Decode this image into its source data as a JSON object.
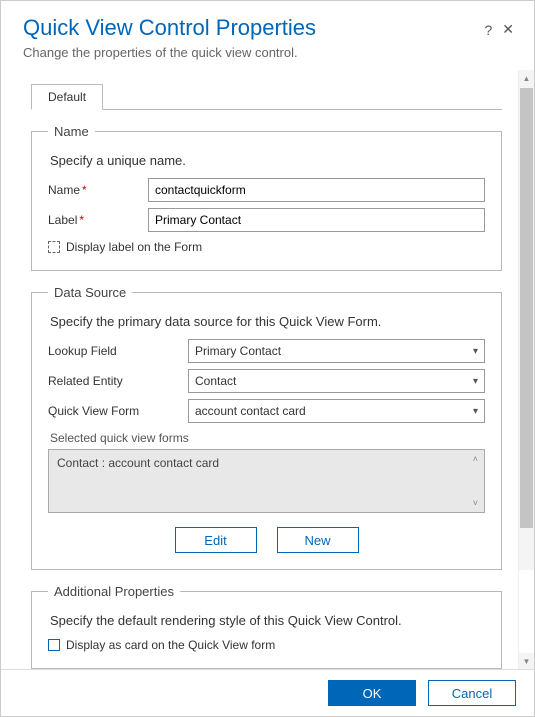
{
  "header": {
    "title": "Quick View Control Properties",
    "subtitle": "Change the properties of the quick view control."
  },
  "tabs": {
    "default": "Default"
  },
  "name_section": {
    "legend": "Name",
    "desc": "Specify a unique name.",
    "name_label": "Name",
    "name_value": "contactquickform",
    "label_label": "Label",
    "label_value": "Primary Contact",
    "display_label": "Display label on the Form"
  },
  "data_section": {
    "legend": "Data Source",
    "desc": "Specify the primary data source for this Quick View Form.",
    "lookup_label": "Lookup Field",
    "lookup_value": "Primary Contact",
    "related_label": "Related Entity",
    "related_value": "Contact",
    "qvf_label": "Quick View Form",
    "qvf_value": "account contact card",
    "selected_label": "Selected quick view forms",
    "selected_item": "Contact : account contact card",
    "edit_btn": "Edit",
    "new_btn": "New"
  },
  "additional_section": {
    "legend": "Additional Properties",
    "desc": "Specify the default rendering style of this Quick View Control.",
    "card_label": "Display as card on the Quick View form"
  },
  "footer": {
    "ok": "OK",
    "cancel": "Cancel"
  }
}
